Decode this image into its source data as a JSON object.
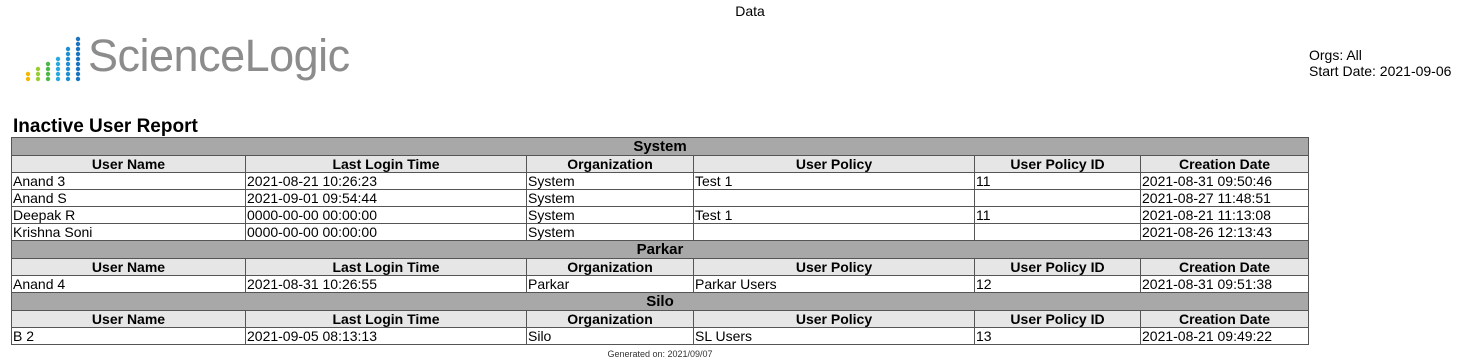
{
  "page": {
    "top_title": "Data",
    "logo_text": "ScienceLogic",
    "orgs": "Orgs: All",
    "start_date": "Start Date: 2021-09-06",
    "report_title": "Inactive User Report",
    "footer": "Generated on: 2021/09/07"
  },
  "columns": [
    "User Name",
    "Last Login Time",
    "Organization",
    "User Policy",
    "User Policy ID",
    "Creation Date"
  ],
  "sections": [
    {
      "name": "System",
      "rows": [
        [
          "Anand 3",
          "2021-08-21 10:26:23",
          "System",
          "Test 1",
          "11",
          "2021-08-31 09:50:46"
        ],
        [
          "Anand S",
          "2021-09-01 09:54:44",
          "System",
          "",
          "",
          "2021-08-27 11:48:51"
        ],
        [
          "Deepak R",
          "0000-00-00 00:00:00",
          "System",
          "Test 1",
          "11",
          "2021-08-21 11:13:08"
        ],
        [
          "Krishna Soni",
          "0000-00-00 00:00:00",
          "System",
          "",
          "",
          "2021-08-26 12:13:43"
        ]
      ]
    },
    {
      "name": "Parkar",
      "rows": [
        [
          "Anand 4",
          "2021-08-31 10:26:55",
          "Parkar",
          "Parkar Users",
          "12",
          "2021-08-31 09:51:38"
        ]
      ]
    },
    {
      "name": "Silo",
      "rows": [
        [
          "B 2",
          "2021-09-05 08:13:13",
          "Silo",
          "SL Users",
          "13",
          "2021-08-21 09:49:22"
        ]
      ]
    }
  ],
  "colors": {
    "section_header_bg": "#a8a8a8",
    "column_header_bg": "#e6e6e6",
    "logo_text": "#8c8c8c"
  }
}
